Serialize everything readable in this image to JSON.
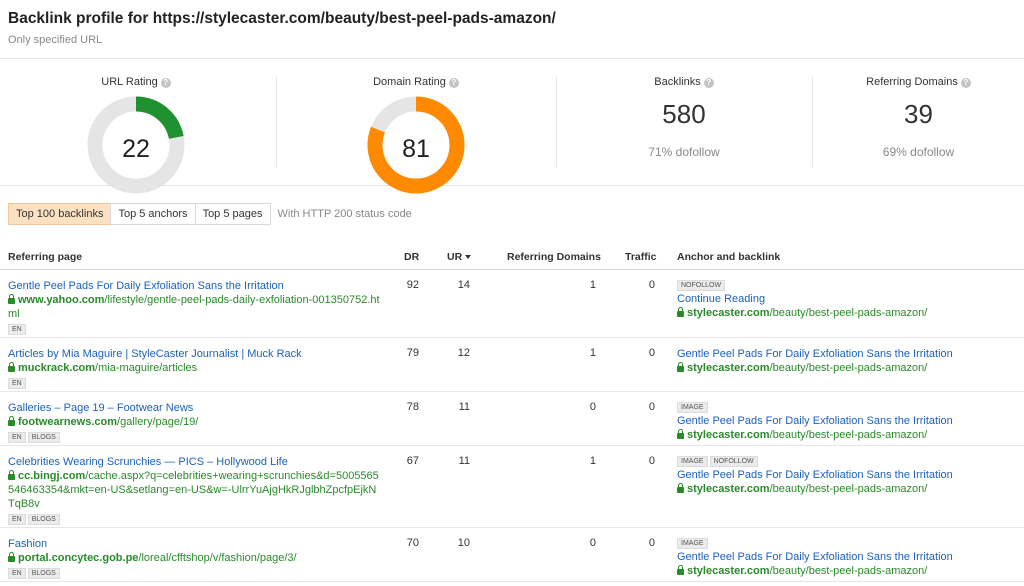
{
  "header": {
    "title": "Backlink profile for https://stylecaster.com/beauty/best-peel-pads-amazon/",
    "subtitle": "Only specified URL"
  },
  "metrics": {
    "url_rating": {
      "label": "URL Rating",
      "value": "22",
      "fraction": 0.22,
      "color": "#1f9130"
    },
    "domain_rating": {
      "label": "Domain Rating",
      "value": "81",
      "fraction": 0.81,
      "color": "#ff8a00"
    },
    "backlinks": {
      "label": "Backlinks",
      "value": "580",
      "sub": "71% dofollow"
    },
    "referring_domains": {
      "label": "Referring Domains",
      "value": "39",
      "sub": "69% dofollow"
    }
  },
  "tabs": {
    "items": [
      "Top 100 backlinks",
      "Top 5 anchors",
      "Top 5 pages"
    ],
    "active": "Top 100 backlinks",
    "note": "With HTTP 200 status code"
  },
  "table": {
    "headers": {
      "referring_page": "Referring page",
      "dr": "DR",
      "ur": "UR",
      "referring_domains": "Referring Domains",
      "traffic": "Traffic",
      "anchor": "Anchor and backlink"
    },
    "rows": [
      {
        "title": "Gentle Peel Pads For Daily Exfoliation Sans the Irritation",
        "domain": "www.yahoo.com",
        "path": "/lifestyle/gentle-peel-pads-daily-exfoliation-001350752.html",
        "tags": [
          "EN"
        ],
        "dr": "92",
        "ur": "14",
        "rd": "1",
        "traffic": "0",
        "anchor_tags": [
          "NOFOLLOW"
        ],
        "anchor_text": "Continue Reading",
        "target_domain": "stylecaster.com",
        "target_path": "/beauty/best-peel-pads-amazon/"
      },
      {
        "title": "Articles by Mia Maguire | StyleCaster Journalist | Muck Rack",
        "domain": "muckrack.com",
        "path": "/mia-maguire/articles",
        "tags": [
          "EN"
        ],
        "dr": "79",
        "ur": "12",
        "rd": "1",
        "traffic": "0",
        "anchor_tags": [],
        "anchor_text": "Gentle Peel Pads For Daily Exfoliation Sans the Irritation",
        "target_domain": "stylecaster.com",
        "target_path": "/beauty/best-peel-pads-amazon/"
      },
      {
        "title": "Galleries – Page 19 – Footwear News",
        "domain": "footwearnews.com",
        "path": "/gallery/page/19/",
        "tags": [
          "EN",
          "BLOGS"
        ],
        "dr": "78",
        "ur": "11",
        "rd": "0",
        "traffic": "0",
        "anchor_tags": [
          "IMAGE"
        ],
        "anchor_text": "Gentle Peel Pads For Daily Exfoliation Sans the Irritation",
        "target_domain": "stylecaster.com",
        "target_path": "/beauty/best-peel-pads-amazon/"
      },
      {
        "title": "Celebrities Wearing Scrunchies — PICS – Hollywood Life",
        "domain": "cc.bingj.com",
        "path": "/cache.aspx?q=celebrities+wearing+scrunchies&d=5005565546463354&mkt=en-US&setlang=en-US&w=-UlrrYuAjgHkRJglbhZpcfpEjkNTqB8v",
        "tags": [
          "EN",
          "BLOGS"
        ],
        "dr": "67",
        "ur": "11",
        "rd": "1",
        "traffic": "0",
        "anchor_tags": [
          "IMAGE",
          "NOFOLLOW"
        ],
        "anchor_text": "Gentle Peel Pads For Daily Exfoliation Sans the Irritation",
        "target_domain": "stylecaster.com",
        "target_path": "/beauty/best-peel-pads-amazon/"
      },
      {
        "title": "Fashion",
        "domain": "portal.concytec.gob.pe",
        "path": "/loreal/cfftshop/v/fashion/page/3/",
        "tags": [
          "EN",
          "BLOGS"
        ],
        "dr": "70",
        "ur": "10",
        "rd": "0",
        "traffic": "0",
        "anchor_tags": [
          "IMAGE"
        ],
        "anchor_text": "Gentle Peel Pads For Daily Exfoliation Sans the Irritation",
        "target_domain": "stylecaster.com",
        "target_path": "/beauty/best-peel-pads-amazon/"
      }
    ]
  }
}
